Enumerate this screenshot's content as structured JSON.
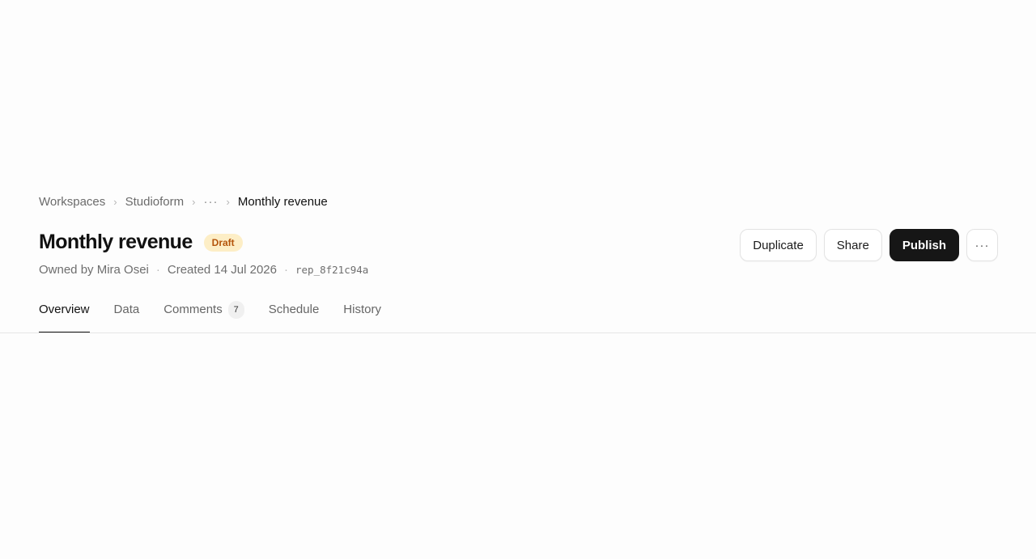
{
  "breadcrumb": {
    "items": [
      "Workspaces",
      "Studioform"
    ],
    "ellipsis": "···",
    "current": "Monthly revenue",
    "separator": "›"
  },
  "header": {
    "title": "Monthly revenue",
    "status": "Draft",
    "owner": "Owned by Mira Osei",
    "created": "Created 14 Jul 2026",
    "id": "rep_8f21c94a",
    "meta_separator": "·"
  },
  "actions": {
    "duplicate": "Duplicate",
    "share": "Share",
    "publish": "Publish",
    "more": "···"
  },
  "tabs": [
    {
      "label": "Overview",
      "active": true
    },
    {
      "label": "Data"
    },
    {
      "label": "Comments",
      "count": "7"
    },
    {
      "label": "Schedule"
    },
    {
      "label": "History"
    }
  ],
  "colors": {
    "badge_bg": "#fdeec6",
    "badge_text": "#b4540a",
    "primary": "#161616"
  }
}
